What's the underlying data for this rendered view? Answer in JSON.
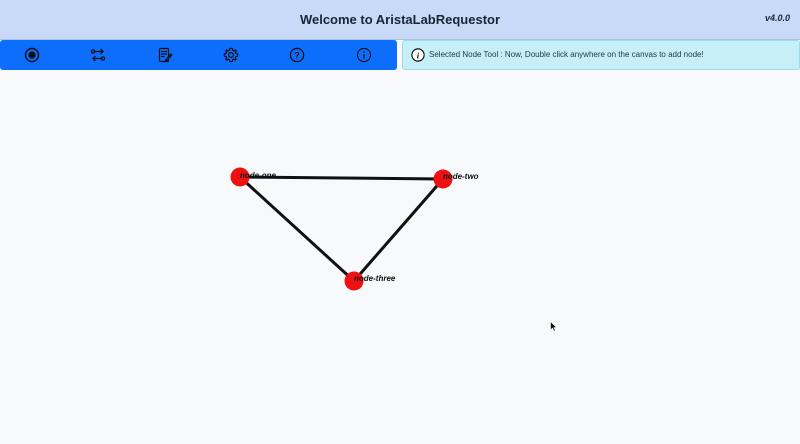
{
  "header": {
    "title": "Welcome to AristaLabRequestor",
    "version": "v4.0.0"
  },
  "toolbar": {
    "tools": [
      {
        "icon": "record-node-icon"
      },
      {
        "icon": "connect-links-icon"
      },
      {
        "icon": "edit-notes-icon"
      },
      {
        "icon": "gear-icon"
      },
      {
        "icon": "help-icon"
      },
      {
        "icon": "info-icon"
      }
    ]
  },
  "banner": {
    "icon": "info-icon",
    "text": "Selected Node Tool : Now, Double click anywhere on the canvas to add node!"
  },
  "graph": {
    "nodes": [
      {
        "id": "node-one",
        "label": "node-one"
      },
      {
        "id": "node-two",
        "label": "node-two"
      },
      {
        "id": "node-three",
        "label": "node-three"
      }
    ],
    "links": [
      {
        "source": "node-one",
        "target": "node-two"
      },
      {
        "source": "node-one",
        "target": "node-three"
      },
      {
        "source": "node-two",
        "target": "node-three"
      }
    ]
  },
  "colors": {
    "header_bg": "#c9d9f8",
    "toolbar_bg": "#0d6efd",
    "banner_bg": "#c6eff7",
    "node_fill": "#ee1111",
    "link_color": "#111111"
  }
}
